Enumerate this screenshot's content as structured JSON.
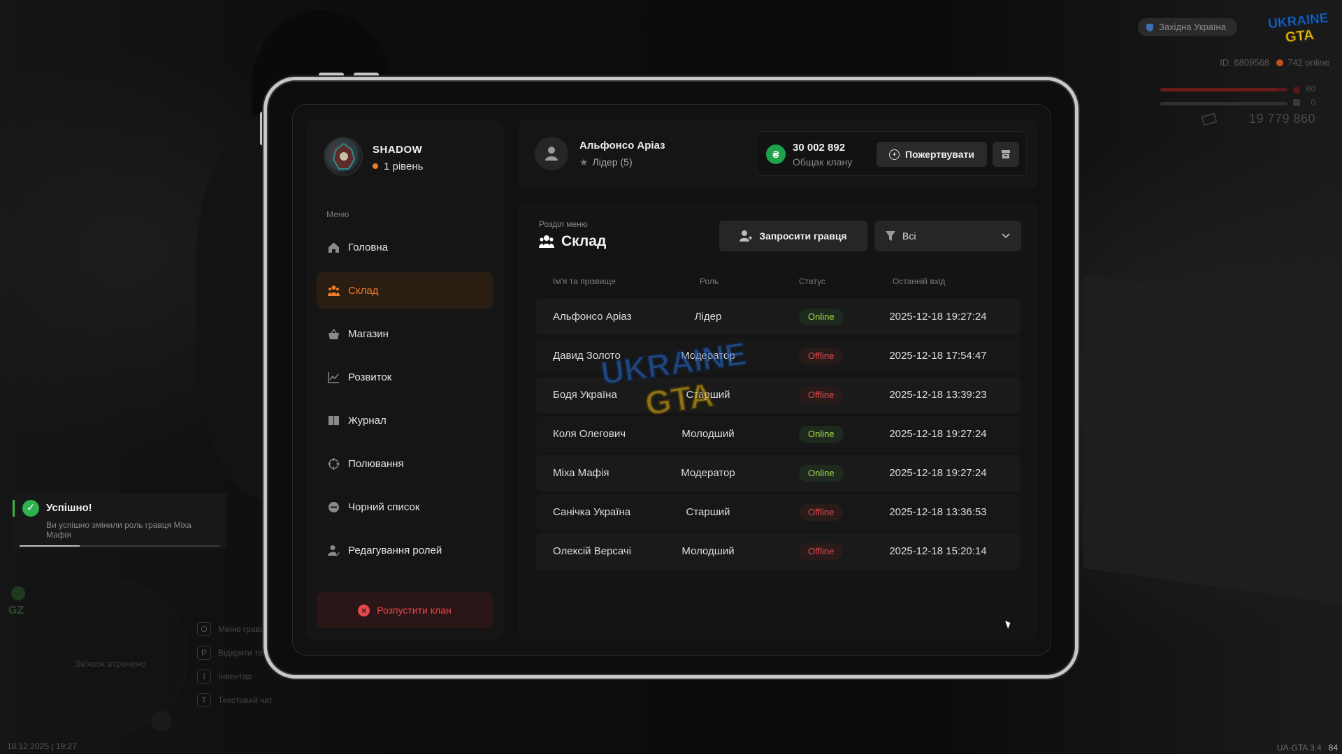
{
  "hud": {
    "server_name": "Західна Україна",
    "id_label": "ID: 6809568",
    "online": "742 online",
    "health_value": "60",
    "health_level": 0.92,
    "armor_value": "0",
    "armor_level": 0,
    "money": "19 779 860",
    "bottom_date": "18.12.2025 | 19:27",
    "version": "UA-GTA 3.4",
    "fps": "84",
    "gz_label": "GZ",
    "radar_text": "Зв'язок втрачено",
    "shortcuts": [
      {
        "key": "O",
        "label": "Меню гравця"
      },
      {
        "key": "P",
        "label": "Відкрити телефон"
      },
      {
        "key": "I",
        "label": "Інвентар"
      },
      {
        "key": "T",
        "label": "Текстовий чат"
      }
    ]
  },
  "notification": {
    "title": "Успішно!",
    "text": "Ви успішно змінили роль гравця Міха Мафія",
    "progress": 0.3
  },
  "clan": {
    "name": "SHADOW",
    "level": "1 рівень"
  },
  "menu": {
    "caption": "Меню",
    "items": [
      {
        "label": "Головна",
        "icon": "home-icon"
      },
      {
        "label": "Склад",
        "icon": "members-icon",
        "active": true
      },
      {
        "label": "Магазин",
        "icon": "basket-icon"
      },
      {
        "label": "Розвиток",
        "icon": "chart-icon"
      },
      {
        "label": "Журнал",
        "icon": "book-icon"
      },
      {
        "label": "Полювання",
        "icon": "crosshair-icon"
      },
      {
        "label": "Чорний список",
        "icon": "blocked-icon"
      },
      {
        "label": "Редагування ролей",
        "icon": "user-edit-icon"
      }
    ],
    "disband_label": "Розпустити клан"
  },
  "player": {
    "name": "Альфонсо Аріаз",
    "role": "Лідер (5)"
  },
  "bank": {
    "amount": "30 002 892",
    "caption": "Общак клану",
    "donate_label": "Пожертвувати"
  },
  "section": {
    "caption": "Розділ меню",
    "title": "Склад",
    "invite_label": "Запросити гравця",
    "filter_value": "Всі"
  },
  "table": {
    "columns": [
      "Ім'я та прізвище",
      "Роль",
      "Статус",
      "Останній вхід"
    ],
    "rows": [
      {
        "name": "Альфонсо Аріаз",
        "role": "Лідер",
        "status": "Online",
        "last": "2025-12-18 19:27:24"
      },
      {
        "name": "Давид Золото",
        "role": "Модератор",
        "status": "Offline",
        "last": "2025-12-18 17:54:47"
      },
      {
        "name": "Бодя Україна",
        "role": "Старший",
        "status": "Offline",
        "last": "2025-12-18 13:39:23"
      },
      {
        "name": "Коля Олегович",
        "role": "Молодший",
        "status": "Online",
        "last": "2025-12-18 19:27:24"
      },
      {
        "name": "Міха Мафія",
        "role": "Модератор",
        "status": "Online",
        "last": "2025-12-18 19:27:24"
      },
      {
        "name": "Санічка Україна",
        "role": "Старший",
        "status": "Offline",
        "last": "2025-12-18 13:36:53"
      },
      {
        "name": "Олексій Версачі",
        "role": "Молодший",
        "status": "Offline",
        "last": "2025-12-18 15:20:14"
      }
    ]
  },
  "watermark": {
    "line1": "UKRAINE",
    "line2": "GTA"
  },
  "colors": {
    "accent": "#ef7d28",
    "online": "#a7d94a",
    "offline": "#e5484d",
    "bank": "#1fa24a",
    "danger": "#e5484d"
  }
}
